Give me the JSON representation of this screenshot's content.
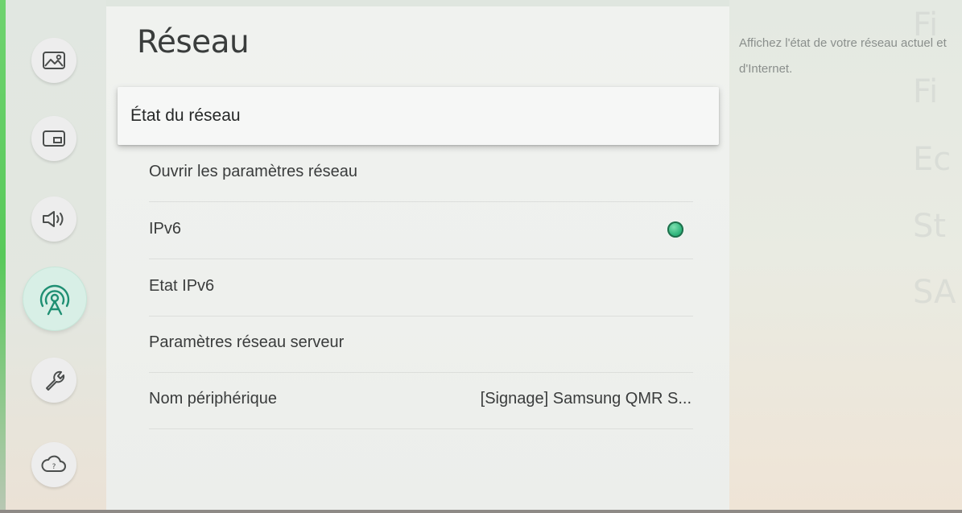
{
  "page_title": "Réseau",
  "help_text": "Affichez l'état de votre réseau actuel et d'Internet.",
  "background_ghost_text": [
    "Fi",
    "Ec",
    "St",
    "SA"
  ],
  "sidebar": {
    "items": [
      {
        "icon": "picture-icon",
        "active": false
      },
      {
        "icon": "screen-icon",
        "active": false
      },
      {
        "icon": "sound-icon",
        "active": false
      },
      {
        "icon": "network-icon",
        "active": true
      },
      {
        "icon": "wrench-icon",
        "active": false
      },
      {
        "icon": "support-icon",
        "active": false
      }
    ]
  },
  "menu": {
    "focused": {
      "label": "État du réseau"
    },
    "items": [
      {
        "label": "Ouvrir les paramètres réseau"
      },
      {
        "label": "IPv6",
        "toggle_on": true
      },
      {
        "label": "Etat IPv6"
      },
      {
        "label": "Paramètres réseau serveur"
      },
      {
        "label": "Nom périphérique",
        "value": "[Signage] Samsung QMR S..."
      }
    ]
  },
  "colors": {
    "toggle_on": "#2fb57c",
    "active_category": "#d8efe6",
    "edge_accent": "#58c95a"
  }
}
